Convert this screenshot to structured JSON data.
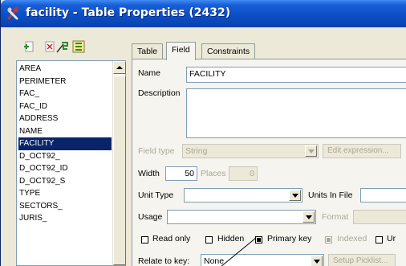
{
  "window": {
    "title": "facility - Table Properties (2432)",
    "title_color": "#ffffff",
    "titlebar_color": "#0b4fc8"
  },
  "field_list": {
    "items": [
      "AREA",
      "PERIMETER",
      "FAC_",
      "FAC_ID",
      "ADDRESS",
      "NAME",
      "FACILITY",
      "D_OCT92_",
      "D_OCT92_ID",
      "D_OCT92_S",
      "TYPE",
      "SECTORS_",
      "JURIS_"
    ],
    "selected": "FACILITY",
    "selected_color": "#0a246a"
  },
  "tabs": [
    {
      "label": "Table",
      "active": false
    },
    {
      "label": "Field",
      "active": true
    },
    {
      "label": "Constraints",
      "active": false
    }
  ],
  "form": {
    "name_label": "Name",
    "name_value": "FACILITY",
    "description_label": "Description",
    "field_type_label": "Field type",
    "field_type_value": "String",
    "edit_expression_label": "Edit expression...",
    "width_label": "Width",
    "width_value": "50",
    "places_label": "Places",
    "places_value": "0",
    "unit_type_label": "Unit Type",
    "units_in_file_label": "Units In File",
    "usage_label": "Usage",
    "format_label": "Format",
    "read_only_label": "Read only",
    "hidden_label": "Hidden",
    "primary_key_label": "Primary key",
    "indexed_label": "Indexed",
    "unique_label_partial": "Ur",
    "relate_to_key_label": "Relate to key:",
    "relate_to_key_value": "None",
    "setup_picklist_label": "Setup Picklist..."
  },
  "checkboxes": {
    "read_only": false,
    "hidden": false,
    "primary_key": true,
    "indexed": true,
    "unique": false
  }
}
